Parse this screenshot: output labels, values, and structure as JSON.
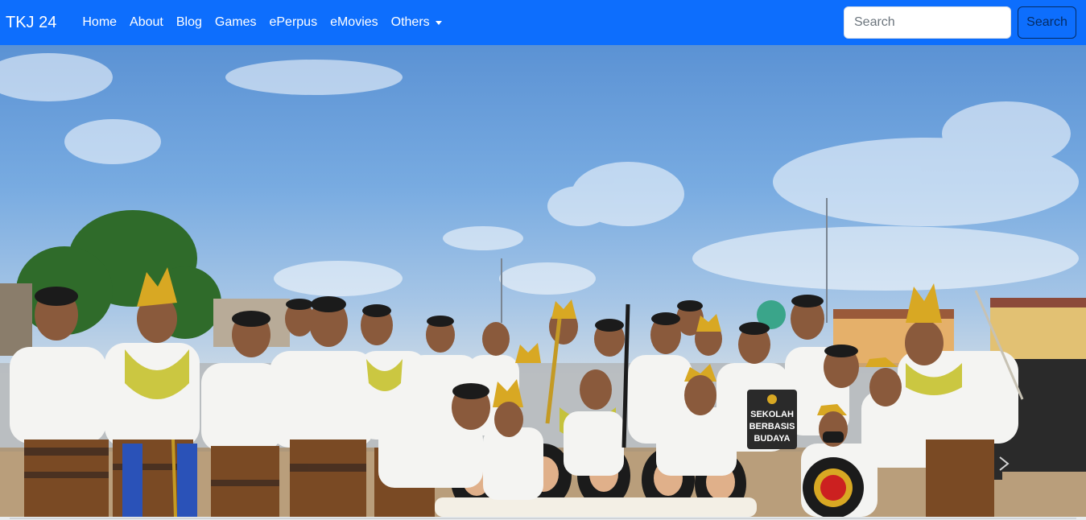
{
  "navbar": {
    "brand": "TKJ 24",
    "items": [
      {
        "label": "Home"
      },
      {
        "label": "About"
      },
      {
        "label": "Blog"
      },
      {
        "label": "Games"
      },
      {
        "label": "ePerpus"
      },
      {
        "label": "eMovies"
      },
      {
        "label": "Others"
      }
    ],
    "search": {
      "placeholder": "Search",
      "button_label": "Search"
    }
  },
  "hero": {
    "sign_text": [
      "SEKOLAH",
      "BERBASIS",
      "BUDAYA"
    ]
  },
  "colors": {
    "navbar_bg": "#0d6efd",
    "nav_text": "#ffffff",
    "search_button_border": "#052c65"
  }
}
